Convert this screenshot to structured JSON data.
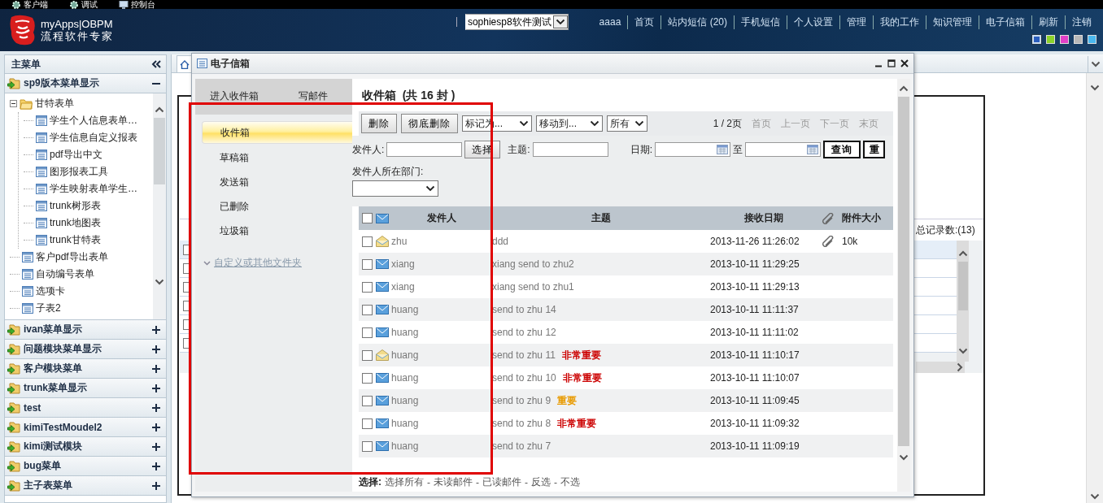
{
  "top_toolbar": [
    {
      "label": "客户端"
    },
    {
      "label": "调试"
    },
    {
      "label": "控制台"
    }
  ],
  "header": {
    "logo_title": "myApps|OBPM",
    "logo_subtitle": "流程软件专家",
    "domain_select": "sophiesp8软件测试",
    "nav_links": [
      "aaaa",
      "首页",
      "站内短信 (20)",
      "手机短信",
      "个人设置",
      "管理",
      "我的工作",
      "知识管理",
      "电子信箱",
      "刷新",
      "注销"
    ],
    "theme_swatches": [
      {
        "color": "#2a5dbd",
        "selected": true
      },
      {
        "color": "#8bd22a",
        "selected": false
      },
      {
        "color": "#e040c8",
        "selected": false
      },
      {
        "color": "#b8b8b8",
        "selected": false
      },
      {
        "color": "#4ab8ee",
        "selected": false
      }
    ]
  },
  "sidebar": {
    "title": "主菜单",
    "sections": [
      {
        "label": "sp9版本菜单显示",
        "expanded": true,
        "items": [
          {
            "label": "甘特表单",
            "kind": "folder",
            "expanded": true,
            "children": [
              {
                "label": "学生个人信息表单…",
                "kind": "form"
              },
              {
                "label": "学生信息自定义报表",
                "kind": "form"
              },
              {
                "label": "pdf导出中文",
                "kind": "form"
              },
              {
                "label": "图形报表工具",
                "kind": "form"
              },
              {
                "label": "学生映射表单学生…",
                "kind": "form"
              },
              {
                "label": "trunk树形表",
                "kind": "form"
              },
              {
                "label": "trunk地图表",
                "kind": "form"
              },
              {
                "label": "trunk甘特表",
                "kind": "form"
              }
            ]
          },
          {
            "label": "客户pdf导出表单",
            "kind": "form"
          },
          {
            "label": "自动编号表单",
            "kind": "form"
          },
          {
            "label": "选项卡",
            "kind": "form"
          },
          {
            "label": "子表2",
            "kind": "form"
          }
        ]
      },
      {
        "label": "ivan菜单显示",
        "expanded": false
      },
      {
        "label": "问题模块菜单显示",
        "expanded": false
      },
      {
        "label": "客户模块菜单",
        "expanded": false
      },
      {
        "label": "trunk菜单显示",
        "expanded": false
      },
      {
        "label": "test",
        "expanded": false
      },
      {
        "label": "kimiTestMoudel2",
        "expanded": false
      },
      {
        "label": "kimi测试模块",
        "expanded": false
      },
      {
        "label": "bug菜单",
        "expanded": false
      },
      {
        "label": "主子表菜单",
        "expanded": false
      }
    ]
  },
  "background_view": {
    "total_records": "总记录数:(13)",
    "rows": [
      {
        "checked": false
      },
      {
        "checked": false
      },
      {
        "checked": false
      },
      {
        "checked": false
      },
      {
        "checked": false
      },
      {
        "checked": false
      }
    ]
  },
  "dialog": {
    "title": "电子信箱",
    "left_tabs": [
      {
        "label": "进入收件箱"
      },
      {
        "label": "写邮件"
      }
    ],
    "folders": [
      {
        "label": "收件箱",
        "selected": true
      },
      {
        "label": "草稿箱",
        "selected": false
      },
      {
        "label": "发送箱",
        "selected": false
      },
      {
        "label": "已删除",
        "selected": false
      },
      {
        "label": "垃圾箱",
        "selected": false
      }
    ],
    "custom_folders_link": "自定义或其他文件夹",
    "heading": "收件箱  (共 16 封 )",
    "buttons": [
      "删除",
      "彻底删除"
    ],
    "selects": [
      "标记为...",
      "移动到...",
      "所有"
    ],
    "pager": {
      "status": "1 / 2页",
      "links": [
        "首页",
        "上一页",
        "下一页",
        "末页"
      ]
    },
    "search": {
      "sender_label": "发件人:",
      "choose_button": "选择",
      "subject_label": "主题:",
      "date_label": "日期:",
      "to_label": "至",
      "query_button": "查询",
      "reset_button": "重",
      "department_label": "发件人所在部门:"
    },
    "table": {
      "select_all_checked": false,
      "columns": [
        "发件人",
        "主题",
        "接收日期",
        "附件大小"
      ],
      "rows": [
        {
          "checked": false,
          "read": true,
          "sender": "zhu",
          "subject": "ddd",
          "date": "2013-11-26 11:26:02",
          "attachment": true,
          "size": "10k"
        },
        {
          "checked": false,
          "read": false,
          "sender": "xiang",
          "subject": "xiang send to zhu2",
          "date": "2013-10-11 11:29:25",
          "attachment": false
        },
        {
          "checked": false,
          "read": false,
          "sender": "xiang",
          "subject": "xiang send to zhu1",
          "date": "2013-10-11 11:29:13",
          "attachment": false
        },
        {
          "checked": false,
          "read": false,
          "sender": "huang",
          "subject": "send to zhu 14",
          "date": "2013-10-11 11:11:37",
          "attachment": false
        },
        {
          "checked": false,
          "read": false,
          "sender": "huang",
          "subject": "send to zhu 12",
          "date": "2013-10-11 11:11:02",
          "attachment": false
        },
        {
          "checked": false,
          "read": true,
          "sender": "huang",
          "subject": "send to zhu 11",
          "priority": {
            "label": "非常重要",
            "color": "#cc0000"
          },
          "date": "2013-10-11 11:10:17",
          "attachment": false
        },
        {
          "checked": false,
          "read": false,
          "sender": "huang",
          "subject": "send to zhu 10",
          "priority": {
            "label": "非常重要",
            "color": "#cc0000"
          },
          "date": "2013-10-11 11:10:07",
          "attachment": false
        },
        {
          "checked": false,
          "read": false,
          "sender": "huang",
          "subject": "send to zhu 9",
          "priority": {
            "label": "重要",
            "color": "#e89a00"
          },
          "date": "2013-10-11 11:09:45",
          "attachment": false
        },
        {
          "checked": false,
          "read": false,
          "sender": "huang",
          "subject": "send to zhu 8",
          "priority": {
            "label": "非常重要",
            "color": "#cc0000"
          },
          "date": "2013-10-11 11:09:32",
          "attachment": false
        },
        {
          "checked": false,
          "read": false,
          "sender": "huang",
          "subject": "send to zhu 7",
          "date": "2013-10-11 11:09:19",
          "attachment": false
        }
      ]
    },
    "selection_footer": {
      "label": "选择:",
      "separator": "-",
      "options": [
        "选择所有",
        "未读邮件",
        "已读邮件",
        "反选",
        "不选"
      ]
    }
  }
}
